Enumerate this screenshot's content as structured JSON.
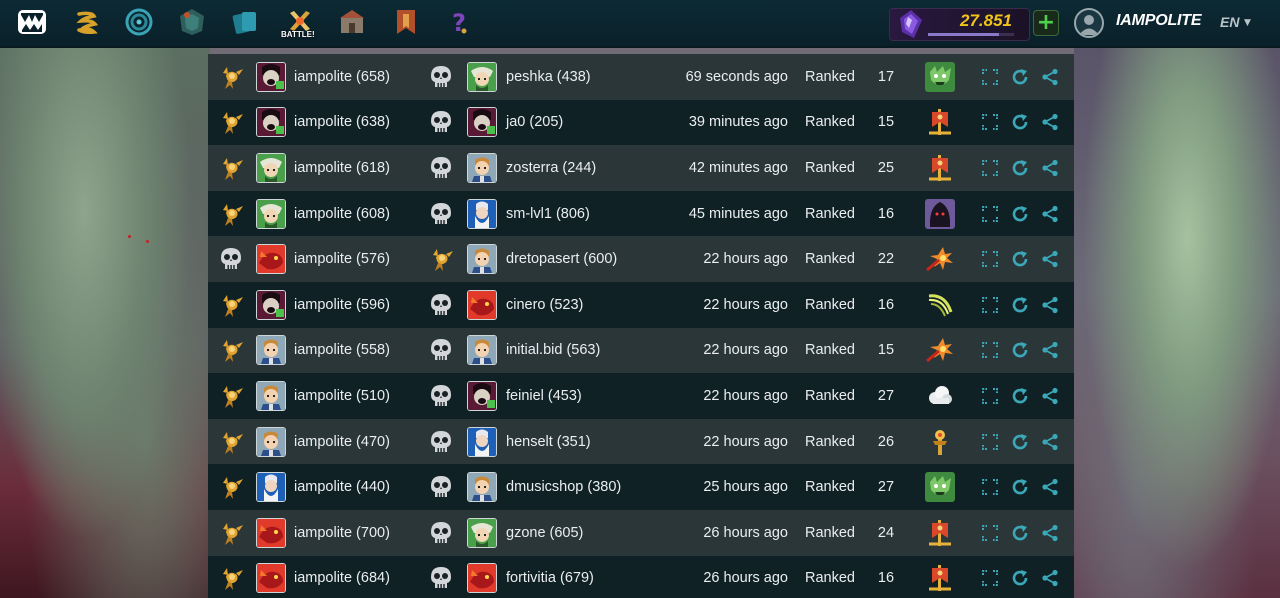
{
  "header": {
    "nav": [
      {
        "name": "logo-icon",
        "color": "#ffffff"
      },
      {
        "name": "quests-icon",
        "color": "#d8a12a"
      },
      {
        "name": "portal-icon",
        "color": "#3aa3b5"
      },
      {
        "name": "packs-icon",
        "color": "#3e7f7c"
      },
      {
        "name": "cards-icon",
        "color": "#2f9bb0"
      },
      {
        "name": "battle-icon",
        "color": "#d9a43a"
      },
      {
        "name": "guild-icon",
        "color": "#8a7a6a"
      },
      {
        "name": "tournament-icon",
        "color": "#b1502a"
      },
      {
        "name": "help-icon",
        "color": "#7d45b8"
      }
    ],
    "battle_label": "BATTLE!",
    "dec_balance": "27.851",
    "dec_progress": 0.82,
    "plus_label": "+",
    "username": "IAMPOLITE",
    "language": "EN"
  },
  "battles": [
    {
      "p1": {
        "result": "win",
        "avatar": "vampire",
        "name": "iampolite (658)"
      },
      "p2": {
        "result": "loss",
        "avatar": "green-mage",
        "name": "peshka (438)"
      },
      "time": "69 seconds ago",
      "mode": "Ranked",
      "mana": "17",
      "ruleset": "green-beast"
    },
    {
      "p1": {
        "result": "win",
        "avatar": "vampire",
        "name": "iampolite (638)"
      },
      "p2": {
        "result": "loss",
        "avatar": "vampire",
        "name": "ja0 (205)"
      },
      "time": "39 minutes ago",
      "mode": "Ranked",
      "mana": "15",
      "ruleset": "banner"
    },
    {
      "p1": {
        "result": "win",
        "avatar": "green-mage",
        "name": "iampolite (618)"
      },
      "p2": {
        "result": "loss",
        "avatar": "scholar",
        "name": "zosterra (244)"
      },
      "time": "42 minutes ago",
      "mode": "Ranked",
      "mana": "25",
      "ruleset": "banner"
    },
    {
      "p1": {
        "result": "win",
        "avatar": "green-mage",
        "name": "iampolite (608)"
      },
      "p2": {
        "result": "loss",
        "avatar": "wizard",
        "name": "sm-lvl1 (806)"
      },
      "time": "45 minutes ago",
      "mode": "Ranked",
      "mana": "16",
      "ruleset": "hood"
    },
    {
      "p1": {
        "result": "loss",
        "avatar": "dragon",
        "name": "iampolite (576)"
      },
      "p2": {
        "result": "win",
        "avatar": "scholar",
        "name": "dretopasert (600)"
      },
      "time": "22 hours ago",
      "mode": "Ranked",
      "mana": "22",
      "ruleset": "explode"
    },
    {
      "p1": {
        "result": "win",
        "avatar": "vampire",
        "name": "iampolite (596)"
      },
      "p2": {
        "result": "loss",
        "avatar": "dragon",
        "name": "cinero (523)"
      },
      "time": "22 hours ago",
      "mode": "Ranked",
      "mana": "16",
      "ruleset": "slash"
    },
    {
      "p1": {
        "result": "win",
        "avatar": "scholar",
        "name": "iampolite (558)"
      },
      "p2": {
        "result": "loss",
        "avatar": "scholar",
        "name": "initial.bid (563)"
      },
      "time": "22 hours ago",
      "mode": "Ranked",
      "mana": "15",
      "ruleset": "explode"
    },
    {
      "p1": {
        "result": "win",
        "avatar": "scholar",
        "name": "iampolite (510)"
      },
      "p2": {
        "result": "loss",
        "avatar": "vampire",
        "name": "feiniel (453)"
      },
      "time": "22 hours ago",
      "mode": "Ranked",
      "mana": "27",
      "ruleset": "cloud"
    },
    {
      "p1": {
        "result": "win",
        "avatar": "scholar",
        "name": "iampolite (470)"
      },
      "p2": {
        "result": "loss",
        "avatar": "wizard",
        "name": "henselt (351)"
      },
      "time": "22 hours ago",
      "mode": "Ranked",
      "mana": "26",
      "ruleset": "totem"
    },
    {
      "p1": {
        "result": "win",
        "avatar": "wizard",
        "name": "iampolite (440)"
      },
      "p2": {
        "result": "loss",
        "avatar": "scholar",
        "name": "dmusicshop (380)"
      },
      "time": "25 hours ago",
      "mode": "Ranked",
      "mana": "27",
      "ruleset": "green-beast"
    },
    {
      "p1": {
        "result": "win",
        "avatar": "dragon",
        "name": "iampolite (700)"
      },
      "p2": {
        "result": "loss",
        "avatar": "green-mage",
        "name": "gzone (605)"
      },
      "time": "26 hours ago",
      "mode": "Ranked",
      "mana": "24",
      "ruleset": "banner"
    },
    {
      "p1": {
        "result": "win",
        "avatar": "dragon",
        "name": "iampolite (684)"
      },
      "p2": {
        "result": "loss",
        "avatar": "dragon",
        "name": "fortivitia (679)"
      },
      "time": "26 hours ago",
      "mode": "Ranked",
      "mana": "16",
      "ruleset": "banner"
    }
  ],
  "colors": {
    "accent_teal": "#3aa8b8",
    "win_gold": "#e2a430",
    "loss_skull": "#d2d6d8",
    "dec_gold": "#f0c418"
  }
}
